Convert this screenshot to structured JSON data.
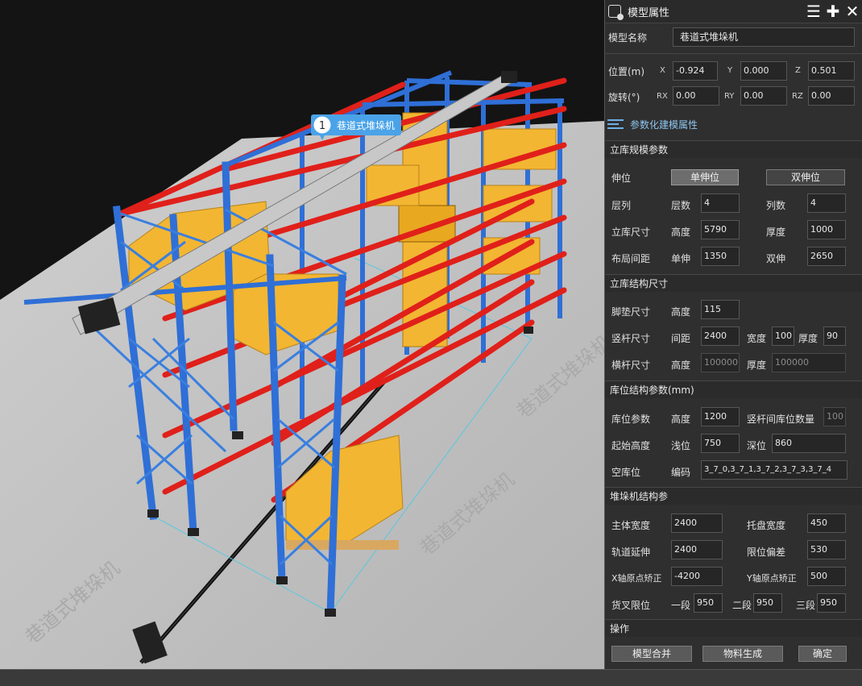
{
  "viewport": {
    "callout": {
      "number": "1",
      "label": "巷道式堆垛机"
    }
  },
  "panel": {
    "title": "模型属性",
    "model_name_label": "模型名称",
    "model_name_value": "巷道式堆垛机",
    "position": {
      "label": "位置(m)",
      "x_label": "X",
      "x": "-0.924",
      "y_label": "Y",
      "y": "0.000",
      "z_label": "Z",
      "z": "0.501"
    },
    "rotation": {
      "label": "旋转(°)",
      "rx_label": "RX",
      "rx": "0.00",
      "ry_label": "RY",
      "ry": "0.00",
      "rz_label": "RZ",
      "rz": "0.00"
    },
    "param_link": "参数化建模属性",
    "scale_section": {
      "title": "立库规模参数",
      "extension": {
        "label": "伸位",
        "single": "单伸位",
        "double": "双伸位"
      },
      "layer_col": {
        "label": "层列",
        "layers_label": "层数",
        "layers": "4",
        "cols_label": "列数",
        "cols": "4"
      },
      "size": {
        "label": "立库尺寸",
        "height_label": "高度",
        "height": "5790",
        "depth_label": "厚度",
        "depth": "1000"
      },
      "spacing": {
        "label": "布局间距",
        "single_label": "单伸",
        "single": "1350",
        "double_label": "双伸",
        "double": "2650"
      }
    },
    "structure_section": {
      "title": "立库结构尺寸",
      "foot": {
        "label": "脚垫尺寸",
        "height_label": "高度",
        "height": "115"
      },
      "upright": {
        "label": "竖杆尺寸",
        "spacing_label": "间距",
        "spacing": "2400",
        "width_label": "宽度",
        "width": "100",
        "depth_label": "厚度",
        "depth": "90"
      },
      "beam": {
        "label": "横杆尺寸",
        "height_label": "高度",
        "height": "100000",
        "depth_label": "厚度",
        "depth": "100000"
      }
    },
    "slot_section": {
      "title": "库位结构参数(mm)",
      "slot": {
        "label": "库位参数",
        "height_label": "高度",
        "height": "1200",
        "count_label": "竖杆间库位数量",
        "count": "100"
      },
      "start": {
        "label": "起始高度",
        "shallow_label": "浅位",
        "shallow": "750",
        "deep_label": "深位",
        "deep": "860"
      },
      "empty": {
        "label": "空库位",
        "code_label": "编码",
        "code": "3_7_0,3_7_1,3_7_2,3_7_3,3_7_4"
      }
    },
    "stacker_section": {
      "title": "堆垛机结构参",
      "row1": {
        "a_label": "主体宽度",
        "a": "2400",
        "b_label": "托盘宽度",
        "b": "450"
      },
      "row2": {
        "a_label": "轨道延伸",
        "a": "2400",
        "b_label": "限位偏差",
        "b": "530"
      },
      "row3": {
        "a_label": "X轴原点矫正",
        "a": "-4200",
        "b_label": "Y轴原点矫正",
        "b": "500"
      },
      "fork": {
        "label": "货叉限位",
        "s1_label": "一段",
        "s1": "950",
        "s2_label": "二段",
        "s2": "950",
        "s3_label": "三段",
        "s3": "950"
      }
    },
    "ops_section": {
      "title": "操作",
      "merge": "模型合并",
      "generate": "物料生成",
      "confirm": "确定"
    }
  },
  "colors": {
    "upright": "#2f6fd6",
    "beam": "#e0201a",
    "box": "#f2b632",
    "floor": "#bdbdbd",
    "accent": "#6fb0e8"
  }
}
